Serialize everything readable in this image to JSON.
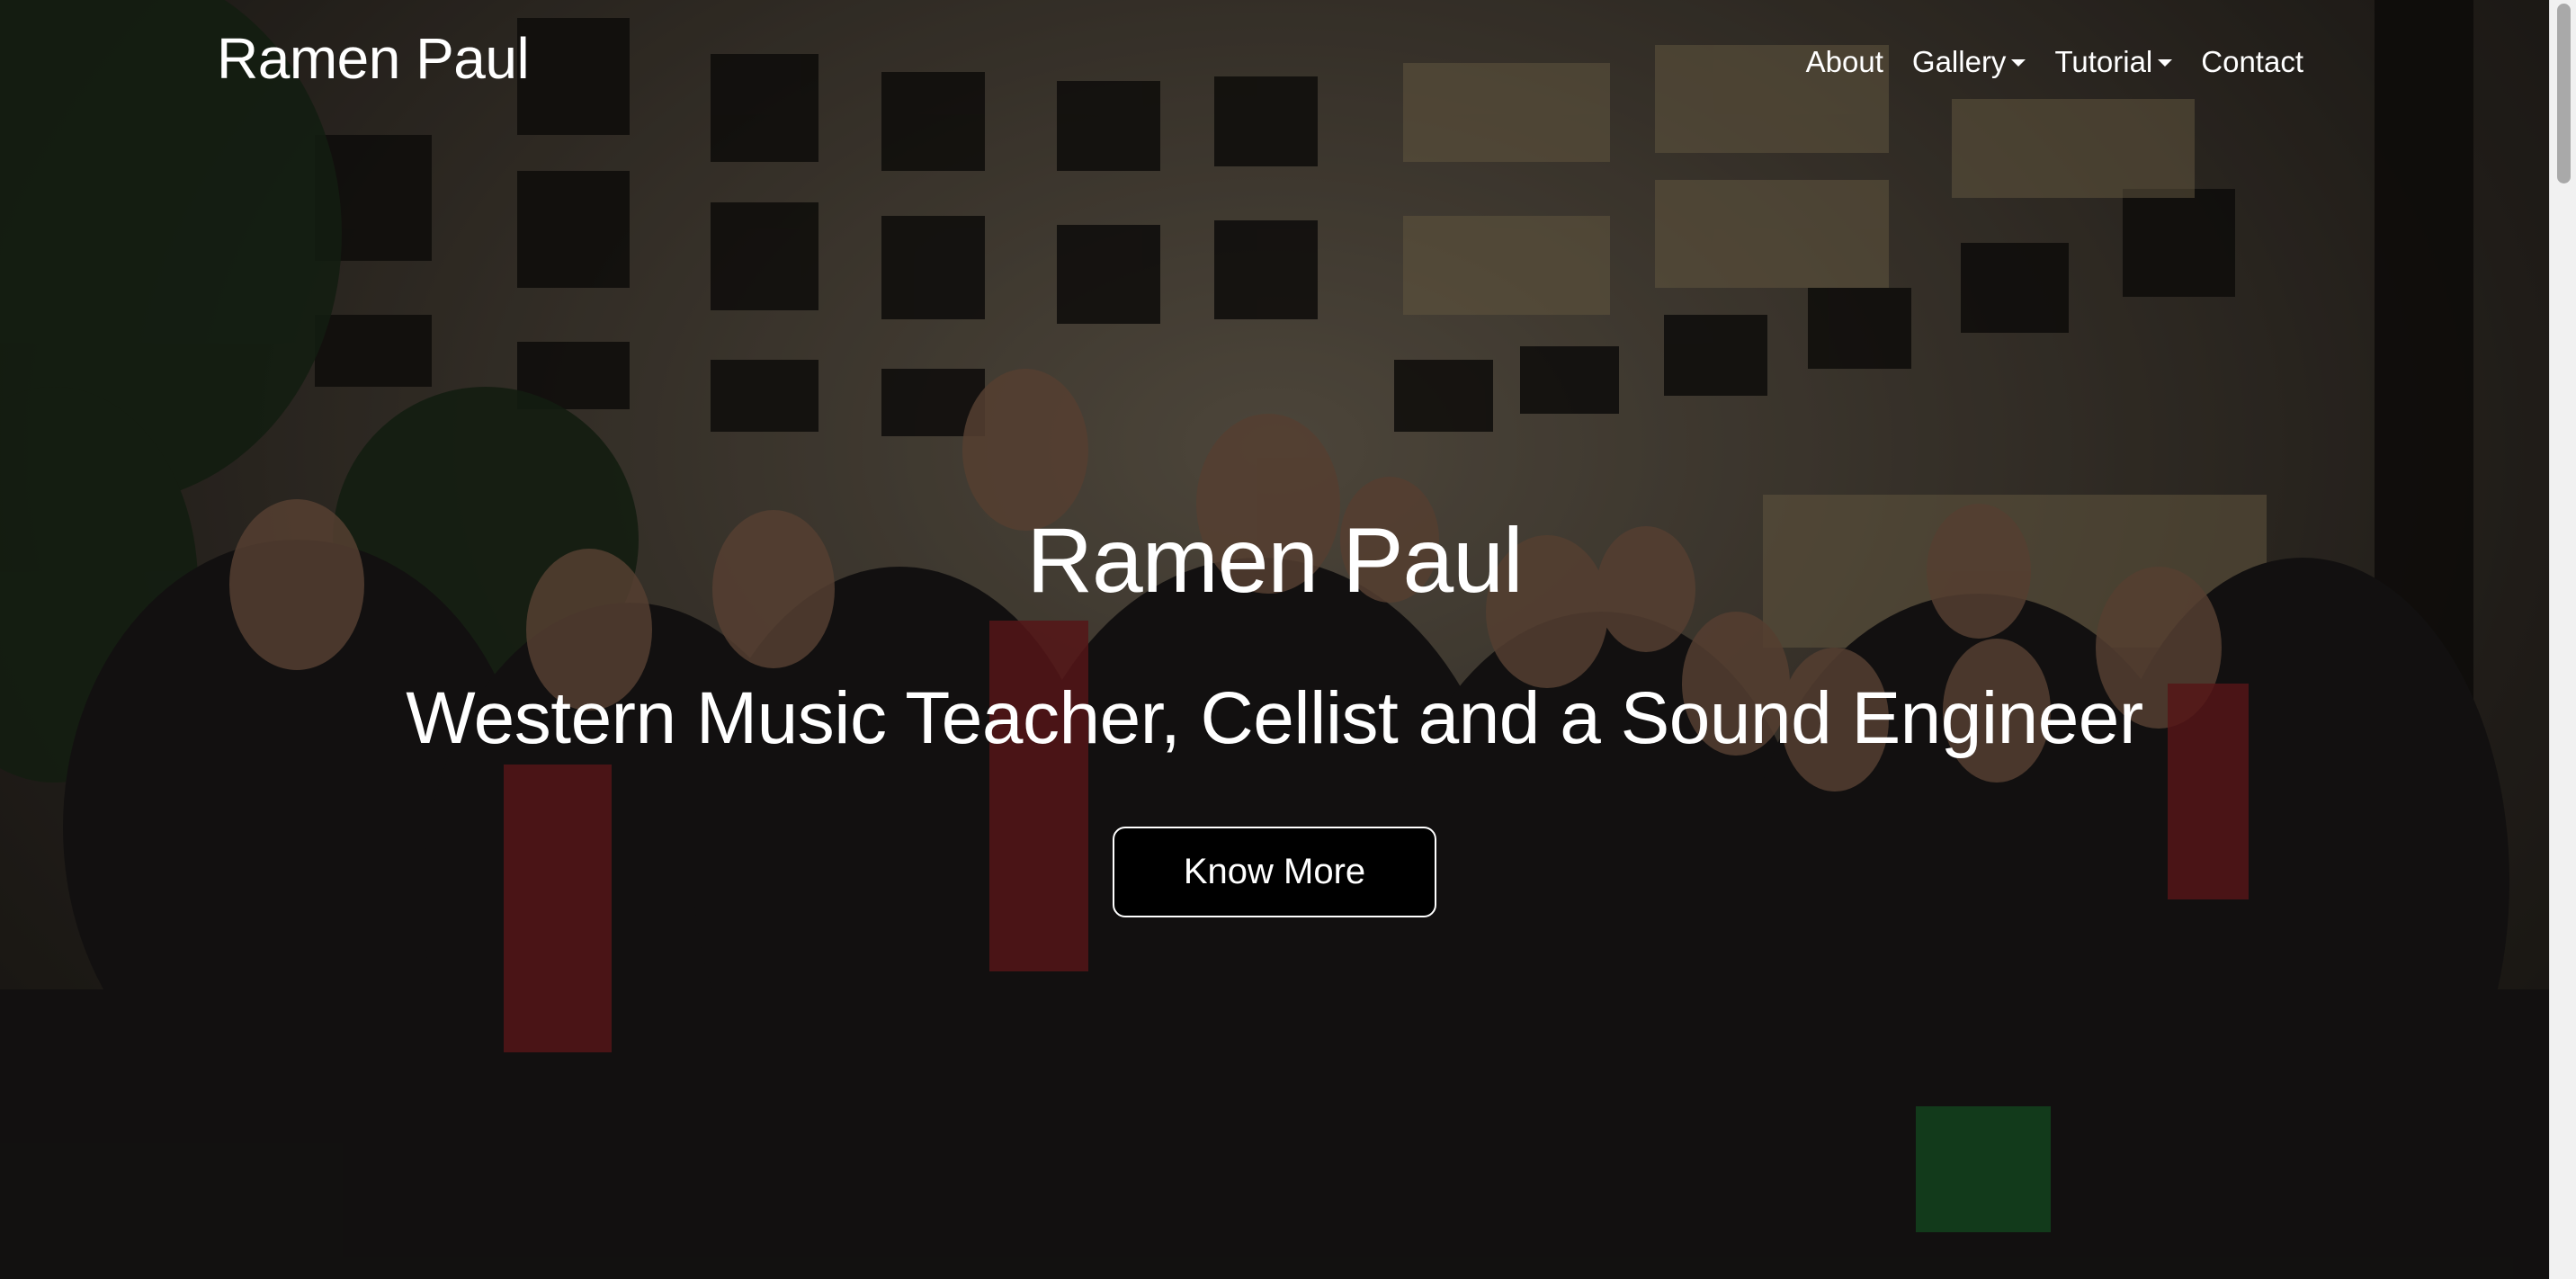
{
  "navbar": {
    "brand": "Ramen Paul",
    "items": [
      {
        "label": "About",
        "dropdown": false
      },
      {
        "label": "Gallery",
        "dropdown": true
      },
      {
        "label": "Tutorial",
        "dropdown": true
      },
      {
        "label": "Contact",
        "dropdown": false
      }
    ]
  },
  "hero": {
    "title": "Ramen Paul",
    "subtitle": "Western Music Teacher, Cellist and a Sound Engineer",
    "cta_label": "Know More",
    "background_image": "group-photo-in-hotel-atrium-at-night",
    "overlay_color": "#000000",
    "text_color": "#ffffff",
    "button_background": "#000000",
    "button_border_color": "#ffffff"
  },
  "icons": {
    "dropdown_caret": "caret-down-icon"
  }
}
